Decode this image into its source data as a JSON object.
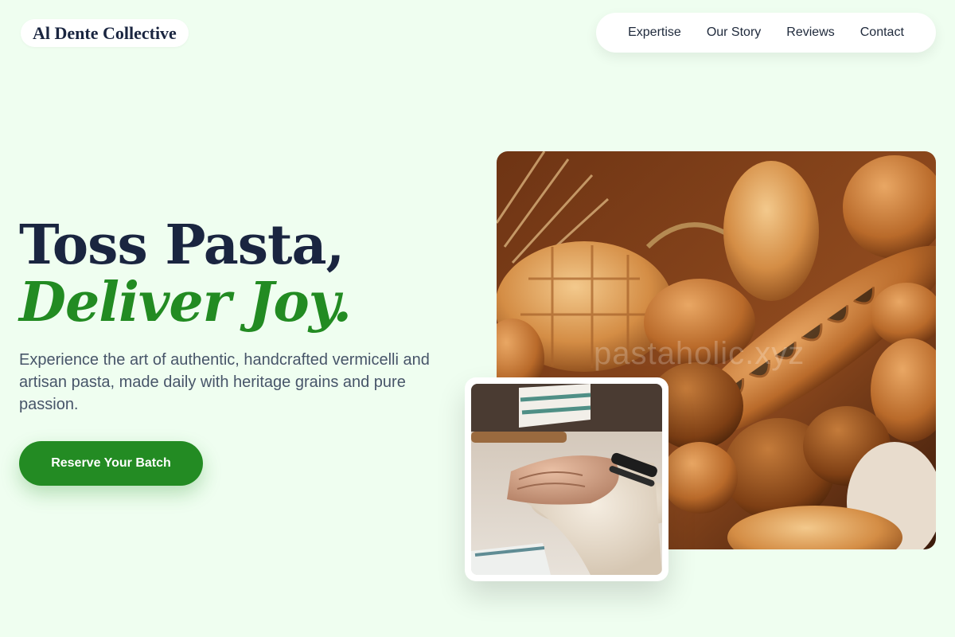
{
  "brand": {
    "name": "Al Dente Collective"
  },
  "nav": {
    "items": [
      {
        "label": "Expertise"
      },
      {
        "label": "Our Story"
      },
      {
        "label": "Reviews"
      },
      {
        "label": "Contact"
      }
    ]
  },
  "hero": {
    "title_line1": "Toss Pasta,",
    "title_line2": "Deliver Joy.",
    "subtitle": "Experience the art of authentic, handcrafted vermicelli and artisan pasta, made daily with heritage grains and pure passion.",
    "cta_label": "Reserve Your Batch"
  },
  "images": {
    "main": "bread-assortment-photo",
    "secondary": "dough-kneading-photo",
    "watermark": "pastaholic.xyz"
  },
  "colors": {
    "background": "#effef0",
    "accent": "#228b22",
    "heading": "#1a2540",
    "body_text": "#475569"
  }
}
